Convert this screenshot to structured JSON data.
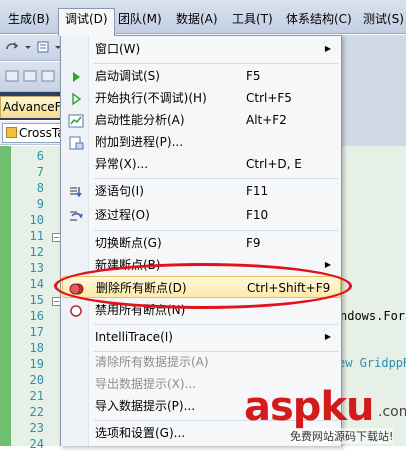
{
  "menubar": {
    "items": [
      {
        "label": "生成(B)"
      },
      {
        "label": "调试(D)"
      },
      {
        "label": "团队(M)"
      },
      {
        "label": "数据(A)"
      },
      {
        "label": "工具(T)"
      },
      {
        "label": "体系结构(C)"
      },
      {
        "label": "测试(S)"
      }
    ]
  },
  "document_tab": {
    "label": "AdvanceFo"
  },
  "class_combo": {
    "label": "CrossTa"
  },
  "editor": {
    "line_numbers": [
      "6",
      "7",
      "8",
      "9",
      "10",
      "11",
      "12",
      "13",
      "14",
      "15",
      "16",
      "17",
      "18",
      "19",
      "20",
      "21",
      "22",
      "23",
      "24"
    ],
    "code_fragments": [
      "ndows.For",
      "ew GridppR"
    ]
  },
  "debug_menu": {
    "items": [
      {
        "label": "窗口(W)",
        "shortcut": "",
        "submenu": true
      },
      {
        "label": "启动调试(S)",
        "shortcut": "F5"
      },
      {
        "label": "开始执行(不调试)(H)",
        "shortcut": "Ctrl+F5"
      },
      {
        "label": "启动性能分析(A)",
        "shortcut": "Alt+F2"
      },
      {
        "label": "附加到进程(P)...",
        "shortcut": ""
      },
      {
        "label": "异常(X)...",
        "shortcut": "Ctrl+D, E"
      },
      {
        "label": "逐语句(I)",
        "shortcut": "F11"
      },
      {
        "label": "逐过程(O)",
        "shortcut": "F10"
      },
      {
        "label": "切换断点(G)",
        "shortcut": "F9"
      },
      {
        "label": "新建断点(B)",
        "shortcut": "",
        "submenu": true
      },
      {
        "label": "删除所有断点(D)",
        "shortcut": "Ctrl+Shift+F9"
      },
      {
        "label": "禁用所有断点(N)",
        "shortcut": ""
      },
      {
        "label": "IntelliTrace(I)",
        "shortcut": "",
        "submenu": true
      },
      {
        "label": "清除所有数据提示(A)",
        "shortcut": ""
      },
      {
        "label": "导出数据提示(X)...",
        "shortcut": ""
      },
      {
        "label": "导入数据提示(P)...",
        "shortcut": ""
      },
      {
        "label": "选项和设置(G)...",
        "shortcut": ""
      }
    ]
  },
  "watermark": {
    "brand_a": "asp",
    "brand_b": "ku",
    "tld": ".com",
    "subtitle": "免费网站源码下载站!"
  },
  "colors": {
    "highlight": "#fde9a8",
    "annotation": "#e0121b",
    "watermark": "#d41b1b"
  }
}
